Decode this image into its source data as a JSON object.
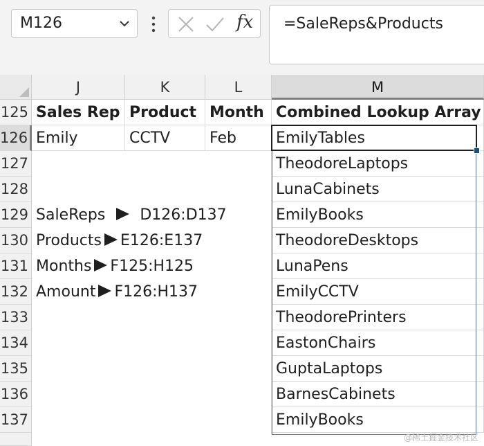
{
  "name_box": {
    "value": "M126"
  },
  "formula_bar": {
    "formula": "=SaleReps&Products",
    "fx_label": "fx"
  },
  "columns": [
    "J",
    "K",
    "L",
    "M"
  ],
  "rows": [
    "125",
    "126",
    "127",
    "128",
    "129",
    "130",
    "131",
    "132",
    "133",
    "134",
    "135",
    "136",
    "137"
  ],
  "headers": {
    "sales_rep": "Sales Rep",
    "product": "Product",
    "month": "Month",
    "combined": "Combined Lookup Array"
  },
  "row126": {
    "sales_rep": "Emily",
    "product": "CCTV",
    "month": "Feb"
  },
  "combined_values": [
    "EmilyTables",
    "TheodoreLaptops",
    "LunaCabinets",
    "EmilyBooks",
    "TheodoreDesktops",
    "LunaPens",
    "EmilyCCTV",
    "TheodorePrinters",
    "EastonChairs",
    "GuptaLaptops",
    "BarnesCabinets",
    "EmilyBooks"
  ],
  "named_ranges": [
    {
      "name": "SaleReps",
      "range": "D126:D137"
    },
    {
      "name": "Products",
      "range": "E126:E137"
    },
    {
      "name": "Months",
      "range": "F125:H125"
    },
    {
      "name": "Amount",
      "range": "F126:H137"
    }
  ],
  "watermark": "@稀土掘金技术社区"
}
